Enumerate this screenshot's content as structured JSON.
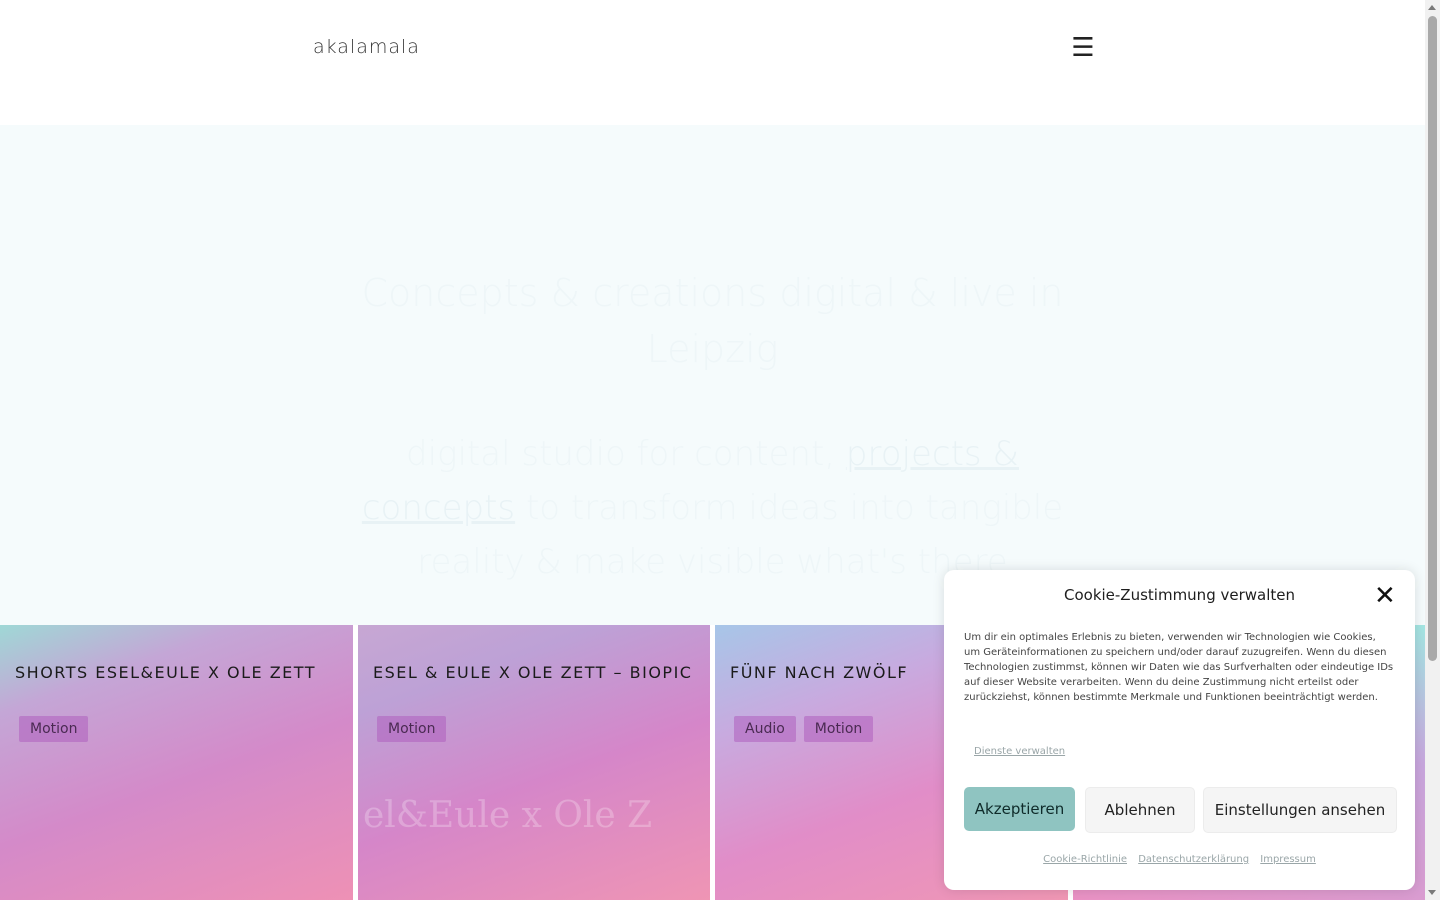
{
  "header": {
    "logo": "akalamala",
    "menu_icon": "☰"
  },
  "hero": {
    "line1": "Concepts & creations digital & live in Leipzig",
    "line2_prefix": "digital studio for content,",
    "line2_link": "projects & concepts",
    "line2_suffix": "to transform ideas into tangible reality & make visible what's there"
  },
  "cards": [
    {
      "title": "SHORTS ESEL&EULE X OLE ZETT",
      "tags": [
        "Motion"
      ],
      "art": ""
    },
    {
      "title": "ESEL & EULE X OLE ZETT – BIOPIC",
      "tags": [
        "Motion"
      ],
      "art": "el&Eule x Ole Z"
    },
    {
      "title": "FÜNF NACH ZWÖLF",
      "tags": [
        "Audio",
        "Motion"
      ],
      "art": ""
    },
    {
      "title": "",
      "tags": [],
      "art": ""
    }
  ],
  "cookie": {
    "title": "Cookie-Zustimmung verwalten",
    "close_icon": "✕",
    "text": "Um dir ein optimales Erlebnis zu bieten, verwenden wir Technologien wie Cookies, um Geräteinformationen zu speichern und/oder darauf zuzugreifen. Wenn du diesen Technologien zustimmst, können wir Daten wie das Surfverhalten oder eindeutige IDs auf dieser Website verarbeiten. Wenn du deine Zustimmung nicht erteilst oder zurückziehst, können bestimmte Merkmale und Funktionen beeinträchtigt werden.",
    "manage_services": "Dienste verwalten",
    "accept": "Akzeptieren",
    "deny": "Ablehnen",
    "settings": "Einstellungen ansehen",
    "links": [
      "Cookie-Richtlinie",
      "Datenschutzerklärung",
      "Impressum"
    ]
  }
}
